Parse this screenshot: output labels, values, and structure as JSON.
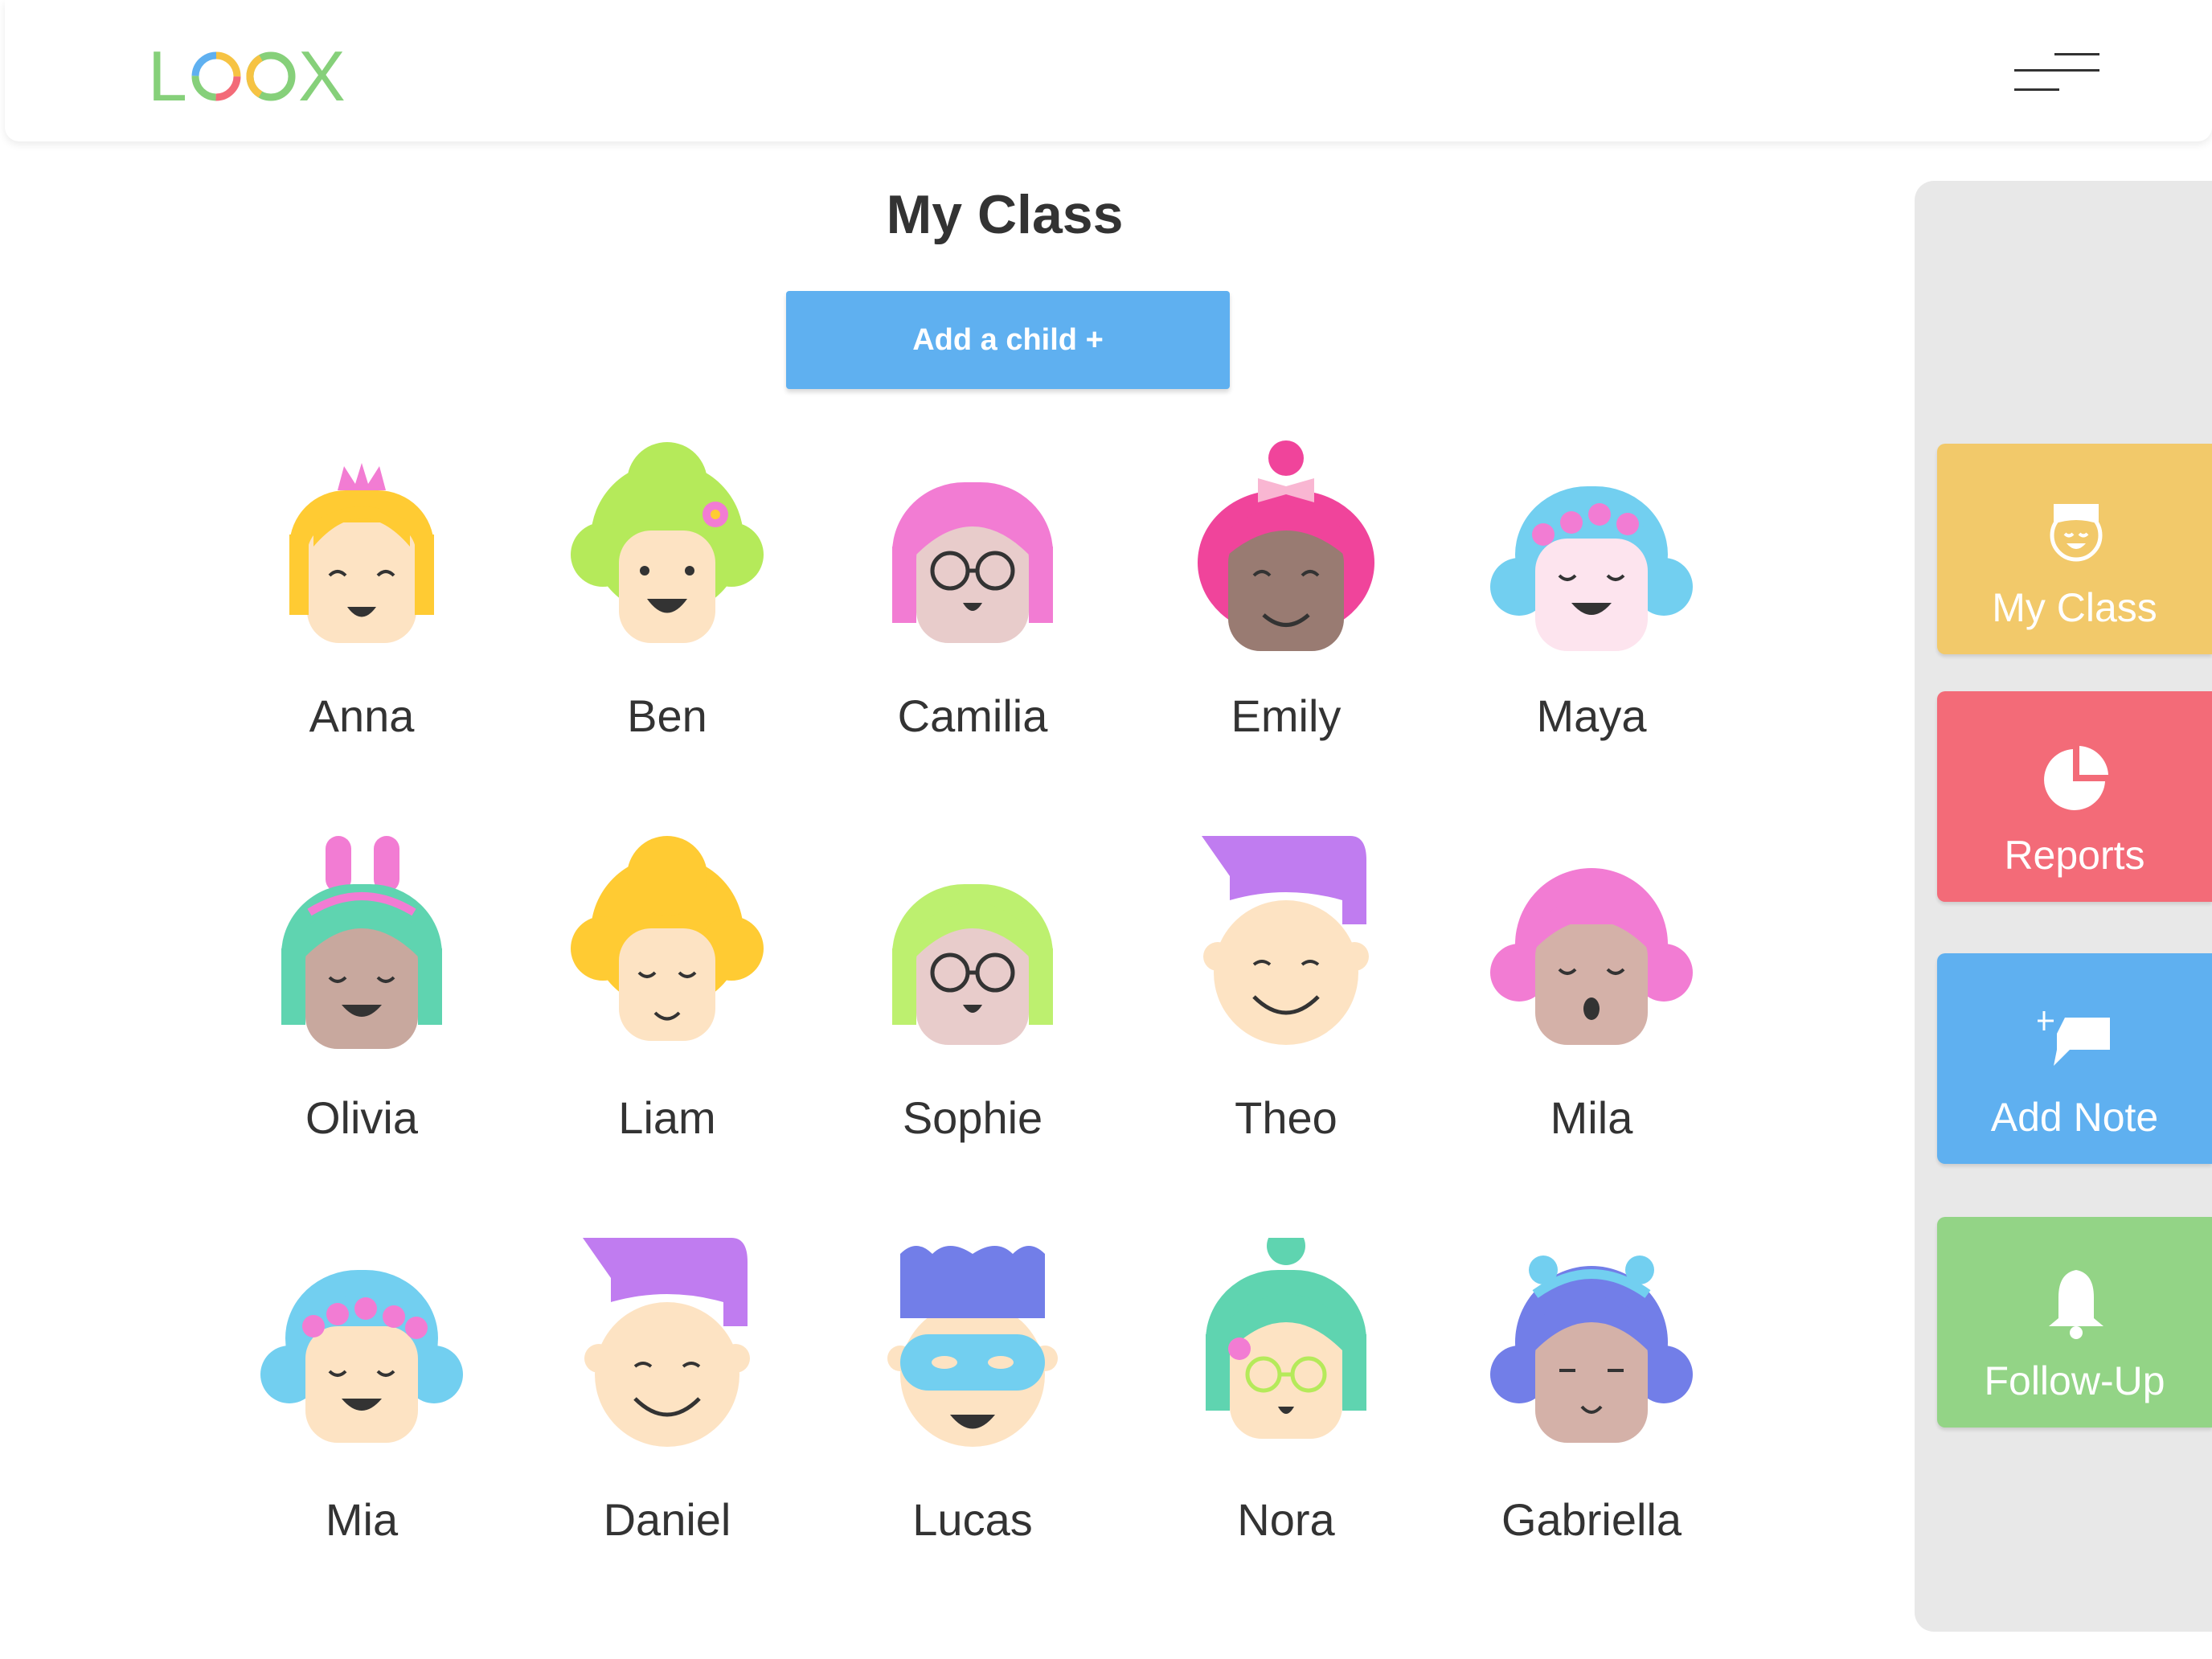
{
  "app": {
    "logo_text_left": "L",
    "logo_text_right": "X"
  },
  "page": {
    "title": "My Class",
    "add_child_label": "Add a child +"
  },
  "children": [
    {
      "name": "Anna"
    },
    {
      "name": "Ben"
    },
    {
      "name": "Camilia"
    },
    {
      "name": "Emily"
    },
    {
      "name": "Maya"
    },
    {
      "name": "Olivia"
    },
    {
      "name": "Liam"
    },
    {
      "name": "Sophie"
    },
    {
      "name": "Theo"
    },
    {
      "name": "Mila"
    },
    {
      "name": "Mia"
    },
    {
      "name": "Daniel"
    },
    {
      "name": "Lucas"
    },
    {
      "name": "Nora"
    },
    {
      "name": "Gabriella"
    }
  ],
  "sidebar": {
    "items": [
      {
        "label": "My Class",
        "icon": "child-face-icon",
        "color": "#f2c96a"
      },
      {
        "label": "Reports",
        "icon": "pie-chart-icon",
        "color": "#f36b78"
      },
      {
        "label": "Add Note",
        "icon": "add-note-icon",
        "color": "#5fb0f0"
      },
      {
        "label": "Follow-Up",
        "icon": "bell-icon",
        "color": "#93d486"
      }
    ]
  },
  "colors": {
    "logo_green": "#86d07a",
    "primary_blue": "#5fb0f0",
    "text_dark": "#333333",
    "sidebar_bg": "#e8e8e8"
  }
}
